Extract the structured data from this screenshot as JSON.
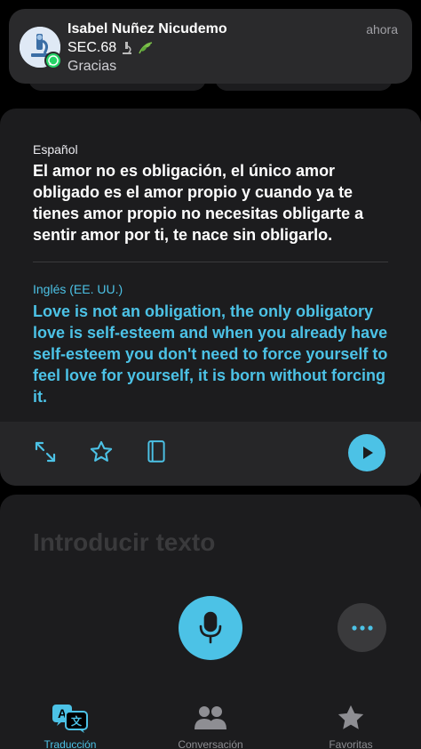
{
  "notification": {
    "sender": "Isabel Nuñez Nicudemo",
    "time": "ahora",
    "subtitle": "SEC.68",
    "message": "Gracias"
  },
  "translation": {
    "source_language": "Español",
    "source_text": "El amor no es obligación, el único amor obligado es el amor propio y cuando ya te tienes amor propio no necesitas obligarte a sentir amor por ti, te nace sin obligarlo.",
    "target_language": "Inglés (EE. UU.)",
    "target_text": "Love is not an obligation, the only obligatory love is self-esteem and when you already have self-esteem you don't need to force yourself to feel love for yourself, it is born without forcing it."
  },
  "toolbar": {
    "icons": [
      "expand-icon",
      "star-icon",
      "book-icon",
      "play-icon"
    ]
  },
  "input": {
    "placeholder": "Introducir texto"
  },
  "tabs": [
    {
      "label": "Traducción",
      "icon": "translate-icon",
      "active": true
    },
    {
      "label": "Conversación",
      "icon": "people-icon",
      "active": false
    },
    {
      "label": "Favoritas",
      "icon": "star-filled-icon",
      "active": false
    }
  ],
  "colors": {
    "accent": "#4cc2e6",
    "background": "#000000",
    "card": "#1c1c1e",
    "inactive": "#8e8e93"
  }
}
